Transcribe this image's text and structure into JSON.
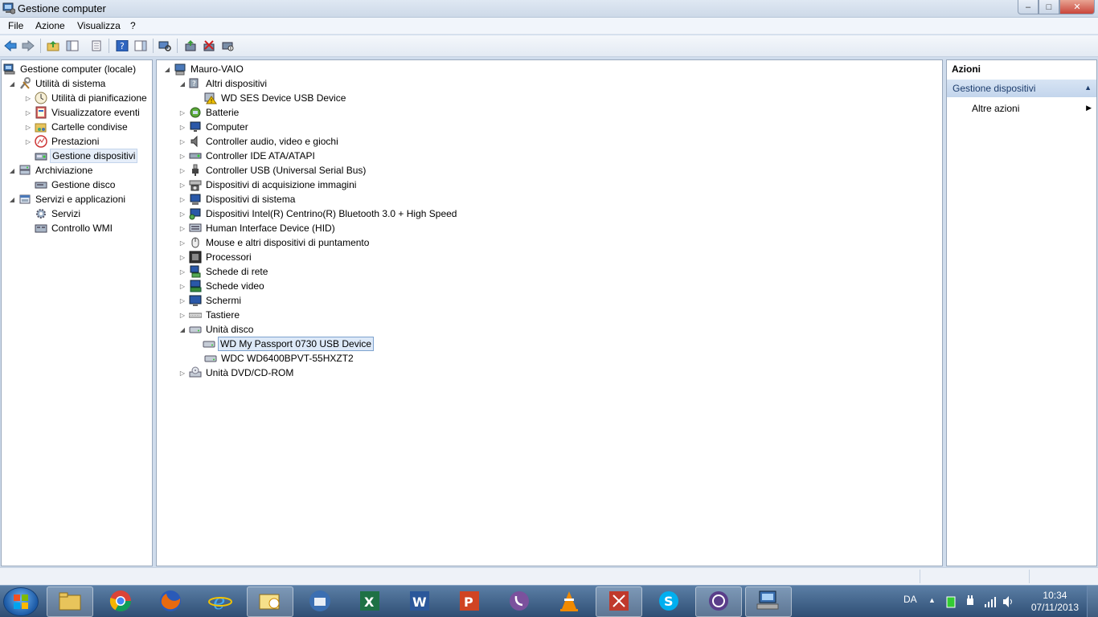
{
  "window": {
    "title": "Gestione computer",
    "btn_min": "–",
    "btn_max": "□",
    "btn_close": "✕"
  },
  "menu": {
    "file": "File",
    "azione": "Azione",
    "visualizza": "Visualizza",
    "help": "?"
  },
  "left_tree": {
    "root": "Gestione computer (locale)",
    "utilita": "Utilità di sistema",
    "pianificazione": "Utilità di pianificazione",
    "eventi": "Visualizzatore eventi",
    "cartelle": "Cartelle condivise",
    "prestazioni": "Prestazioni",
    "dispositivi": "Gestione dispositivi",
    "archiviazione": "Archiviazione",
    "disco": "Gestione disco",
    "servizi_app": "Servizi e applicazioni",
    "servizi": "Servizi",
    "wmi": "Controllo WMI"
  },
  "device_tree": {
    "root": "Mauro-VAIO",
    "altri": "Altri dispositivi",
    "wd_ses": "WD SES Device USB Device",
    "batterie": "Batterie",
    "computer": "Computer",
    "audio": "Controller audio, video e giochi",
    "ide": "Controller IDE ATA/ATAPI",
    "usb": "Controller USB (Universal Serial Bus)",
    "imaging": "Dispositivi di acquisizione immagini",
    "sistema": "Dispositivi di sistema",
    "bluetooth": "Dispositivi Intel(R) Centrino(R) Bluetooth 3.0 + High Speed",
    "hid": "Human Interface Device (HID)",
    "mouse": "Mouse e altri dispositivi di puntamento",
    "processori": "Processori",
    "rete": "Schede di rete",
    "video": "Schede video",
    "schermi": "Schermi",
    "tastiere": "Tastiere",
    "unita_disco": "Unità disco",
    "wd_passport": "WD My Passport 0730 USB Device",
    "wdc": "WDC WD6400BPVT-55HXZT2",
    "dvd": "Unità DVD/CD-ROM"
  },
  "actions": {
    "header": "Azioni",
    "section": "Gestione dispositivi",
    "more": "Altre azioni"
  },
  "taskbar": {
    "lang": "DA",
    "time": "10:34",
    "date": "07/11/2013"
  },
  "colors": {
    "accent": "#1d3d6d",
    "selection": "#dde9f8",
    "taskbar": "#2f4e74"
  }
}
